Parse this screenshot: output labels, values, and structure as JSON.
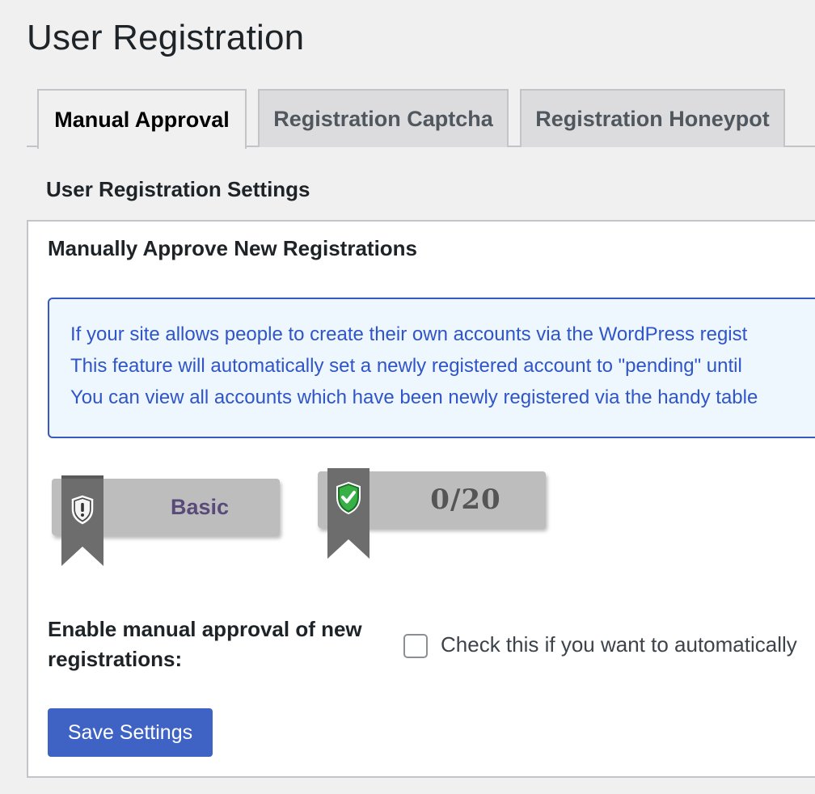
{
  "page": {
    "title": "User Registration"
  },
  "tabs": [
    {
      "label": "Manual Approval",
      "active": true
    },
    {
      "label": "Registration Captcha",
      "active": false
    },
    {
      "label": "Registration Honeypot",
      "active": false
    }
  ],
  "section": {
    "title": "User Registration Settings"
  },
  "panel": {
    "title": "Manually Approve New Registrations",
    "notice_lines": [
      "If your site allows people to create their own accounts via the WordPress regist",
      "This feature will automatically set a newly registered account to \"pending\" until",
      "You can view all accounts which have been newly registered via the handy table"
    ],
    "badges": {
      "level_label": "Basic",
      "level_icon": "shield-exclamation-icon",
      "score_label": "0/20",
      "score_icon": "shield-check-icon"
    },
    "field": {
      "label": "Enable manual approval of new registrations:",
      "checkbox_checked": false,
      "checkbox_label": "Check this if you want to automatically"
    },
    "save_label": "Save Settings"
  },
  "colors": {
    "accent": "#3f63c4",
    "notice_border": "#3858c4",
    "notice_text": "#2f55c8",
    "notice_bg": "#eef6fe",
    "badge_bg": "#bdbdbd",
    "shield_check": "#2ea33a"
  }
}
